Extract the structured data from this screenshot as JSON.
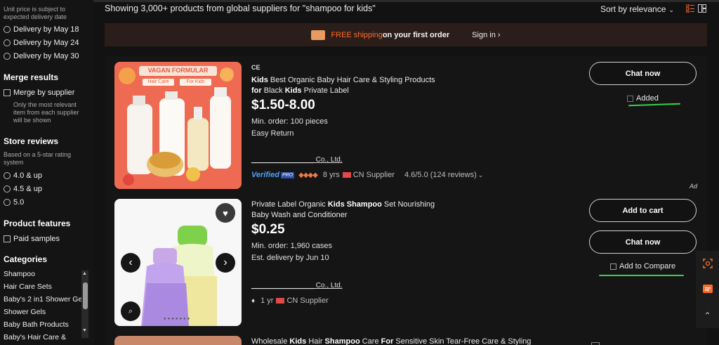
{
  "sidebar": {
    "note": "Unit price is subject to expected delivery date",
    "delivery_options": [
      "Delivery by May 18",
      "Delivery by May 24",
      "Delivery by May 30"
    ],
    "merge": {
      "title": "Merge results",
      "option": "Merge by supplier",
      "note": "Only the most relevant item from each supplier will be shown"
    },
    "reviews": {
      "title": "Store reviews",
      "note": "Based on a 5-star rating system",
      "options": [
        "4.0 & up",
        "4.5 & up",
        "5.0"
      ]
    },
    "features": {
      "title": "Product features",
      "option": "Paid samples"
    },
    "categories": {
      "title": "Categories",
      "items": [
        "Shampoo",
        "Hair Care Sets",
        "Baby's 2 in1 Shower Gel",
        "Shower Gels",
        "Baby Bath Products",
        "Baby's Hair Care &"
      ]
    }
  },
  "header": {
    "result_text": "Showing 3,000+ products from global suppliers for \"shampoo for kids\"",
    "sort_label": "Sort by relevance"
  },
  "banner": {
    "free": "FREE shipping",
    "rest": " on your first order",
    "signin": "Sign in ›"
  },
  "products": [
    {
      "ce_mark": "CE",
      "title_parts": [
        [
          "Kids",
          true
        ],
        [
          " Best Organic Baby Hair Care & Styling Products ",
          false
        ],
        [
          "for",
          true
        ],
        [
          " Black ",
          false
        ],
        [
          "Kids",
          true
        ],
        [
          " Private Label",
          false
        ]
      ],
      "price": "$1.50-8.00",
      "min_order": "Min. order: 100 pieces",
      "extra": "Easy Return",
      "supplier": "________________ Co., Ltd.",
      "verified": "Verified",
      "pro": "PRO",
      "years": "8 yrs",
      "country": "CN Supplier",
      "rating": "4.6/5.0 (124 reviews)",
      "image_banner": "VAGAN FORMULAR",
      "image_tabs": [
        "Hair Care",
        "For Kids"
      ],
      "btn_primary": "Chat now",
      "compare_label": "Added",
      "ad": "Ad"
    },
    {
      "title_parts": [
        [
          "Private Label Organic ",
          false
        ],
        [
          "Kids Shampoo",
          true
        ],
        [
          " Set Nourishing Baby Wash and Conditioner",
          false
        ]
      ],
      "price": "$0.25",
      "min_order": "Min. order: 1,960 cases",
      "extra": "Est. delivery by Jun 10",
      "supplier": "________________ Co., Ltd.",
      "years": "1 yr",
      "country": "CN Supplier",
      "btn_primary": "Add to cart",
      "btn_secondary": "Chat now",
      "compare_label": "Add to Compare"
    },
    {
      "title_parts": [
        [
          "Wholesale ",
          false
        ],
        [
          "Kids",
          true
        ],
        [
          " Hair ",
          false
        ],
        [
          "Shampoo",
          true
        ],
        [
          " Care ",
          false
        ],
        [
          "For",
          true
        ],
        [
          " Sensitive Skin Tear-Free Care & Styling",
          false
        ]
      ]
    }
  ],
  "colors": {
    "accent": "#ff6a2a",
    "green_mark": "#36d24a",
    "bg": "#121212"
  }
}
